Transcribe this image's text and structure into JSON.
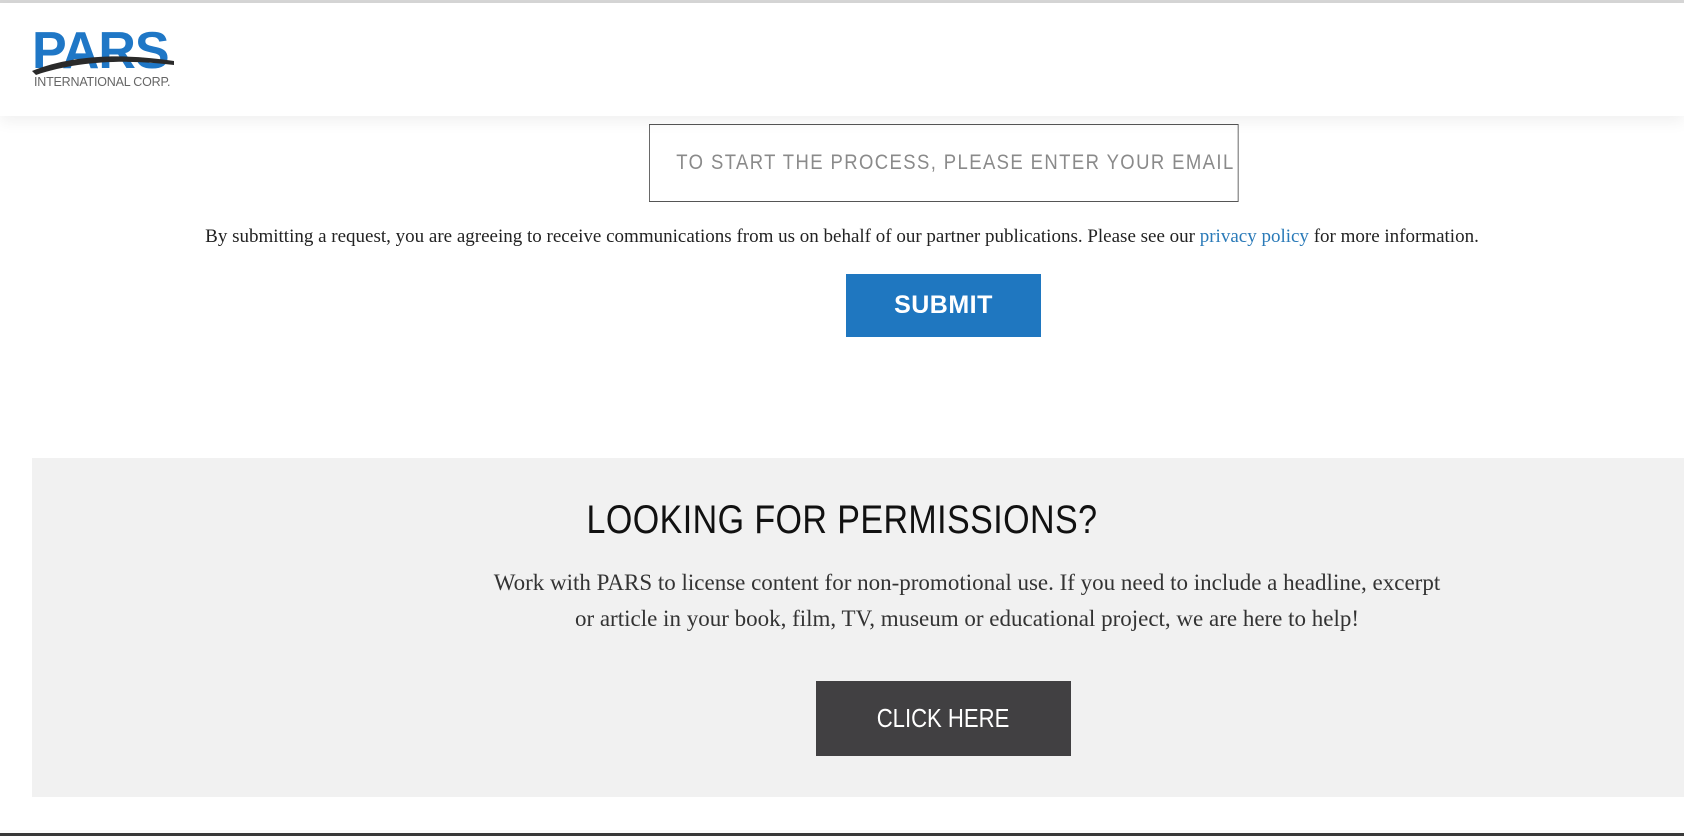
{
  "header": {
    "logo_word": "PARS",
    "logo_sub": "INTERNATIONAL CORP.",
    "brand_color": "#1f77c6"
  },
  "form": {
    "email_placeholder": "TO START THE PROCESS, PLEASE ENTER YOUR EMAIL ADDRESS",
    "email_value": "",
    "consent_before": "By submitting a request, you are agreeing to receive communications from us on behalf of our partner publications. Please see our ",
    "consent_link": "privacy policy",
    "consent_after": " for more information.",
    "submit_label": "SUBMIT",
    "submit_color": "#1f77c0",
    "link_color": "#2a7ab8"
  },
  "permissions": {
    "title": "LOOKING FOR PERMISSIONS?",
    "line1": "Work with PARS to license content for non-promotional use. If you need to include a headline, excerpt",
    "line2": "or article in your book, film, TV, museum or educational project, we are here to help!",
    "cta_label": "CLICK HERE",
    "cta_color": "#414042",
    "background": "#f1f1f1"
  }
}
